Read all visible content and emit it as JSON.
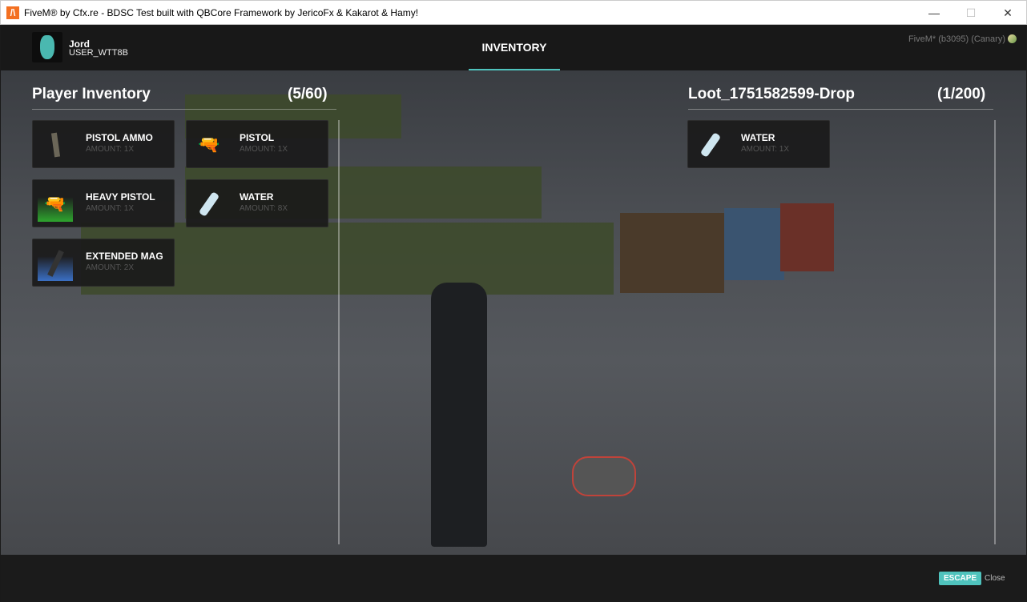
{
  "window": {
    "title": "FiveM® by Cfx.re - BDSC Test built with QBCore Framework by JericoFx & Kakarot & Hamy!",
    "minimize": "—",
    "maximize": "☐",
    "close": "✕"
  },
  "header": {
    "username": "Jord",
    "userid": "USER_WTT8B",
    "tab": "INVENTORY",
    "build": "FiveM* (b3095) (Canary)"
  },
  "player": {
    "title": "Player Inventory",
    "count": "(5/60)",
    "items": [
      {
        "name": "PISTOL AMMO",
        "amount": "AMOUNT: 1X",
        "icon": "ammo-icon",
        "tier": ""
      },
      {
        "name": "PISTOL",
        "amount": "AMOUNT: 1X",
        "icon": "pistol-icon",
        "tier": ""
      },
      {
        "name": "HEAVY PISTOL",
        "amount": "AMOUNT: 1X",
        "icon": "pistol-icon",
        "tier": "#2ea52e"
      },
      {
        "name": "WATER",
        "amount": "AMOUNT: 8X",
        "icon": "water-bottle-icon",
        "tier": ""
      },
      {
        "name": "EXTENDED MAG",
        "amount": "AMOUNT: 2X",
        "icon": "magazine-icon",
        "tier": "#3a6fc4"
      }
    ]
  },
  "loot": {
    "title": "Loot_1751582599-Drop",
    "count": "(1/200)",
    "items": [
      {
        "name": "WATER",
        "amount": "AMOUNT: 1X",
        "icon": "water-bottle-icon",
        "tier": ""
      }
    ]
  },
  "footer": {
    "key": "ESCAPE",
    "action": "Close"
  }
}
